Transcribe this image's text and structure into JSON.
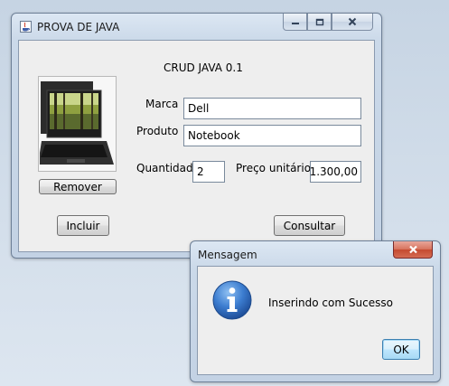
{
  "main_window": {
    "title": "PROVA DE JAVA",
    "heading": "CRUD JAVA 0.1",
    "fields": {
      "marca": {
        "label": "Marca",
        "value": "Dell"
      },
      "produto": {
        "label": "Produto",
        "value": "Notebook"
      },
      "quantidade": {
        "label": "Quantidade",
        "value": "2"
      },
      "preco": {
        "label": "Preço unitário",
        "value": "1.300,00"
      }
    },
    "buttons": {
      "remover": "Remover",
      "incluir": "Incluir",
      "consultar": "Consultar"
    },
    "icons": [
      "java-app-icon",
      "minimize-icon",
      "maximize-icon",
      "close-icon",
      "laptop-photo"
    ]
  },
  "dialog": {
    "title": "Mensagem",
    "message": "Inserindo com Sucesso",
    "ok_label": "OK",
    "icons": [
      "info-icon",
      "close-icon"
    ]
  },
  "colors": {
    "close_red": "#c75050",
    "info_blue": "#2f6fc4",
    "ok_border": "#3c7fb1"
  }
}
